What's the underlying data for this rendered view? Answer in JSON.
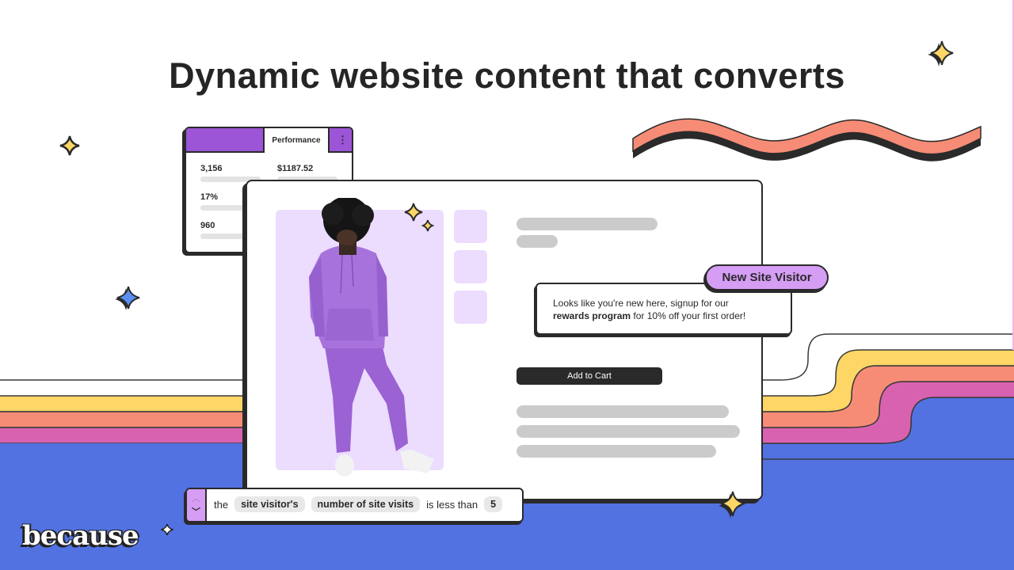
{
  "headline": "Dynamic website content that converts",
  "colors": {
    "purple_accent": "#9b55d6",
    "badge_purple": "#d69df5",
    "lilac_bg": "#ecdcfd",
    "yellow": "#fdd666",
    "salmon": "#f78c76",
    "pink": "#d962b0",
    "blue": "#5272e2",
    "dark": "#2a2a2a",
    "star_blue": "#5b8ef0"
  },
  "performance_card": {
    "tab_label": "Performance",
    "menu_icon": "kebab-menu-icon",
    "stats": [
      {
        "value": "3,156"
      },
      {
        "value": "$1187.52"
      },
      {
        "value": "17%"
      },
      {
        "value": "960"
      }
    ]
  },
  "product_card": {
    "add_to_cart_label": "Add to Cart",
    "image": "person-in-purple-tracksuit"
  },
  "popup": {
    "badge_label": "New Site Visitor",
    "message_line1": "Looks like you're new here, signup for our",
    "message_bold": "rewards program",
    "message_rest": " for 10% off your first order!"
  },
  "rule": {
    "prefix": "the",
    "subject": "site visitor's",
    "attribute": "number of site visits",
    "operator": "is less than",
    "value": "5",
    "up_icon": "chevron-up-icon",
    "down_icon": "chevron-down-icon"
  },
  "logo": {
    "text": "because"
  }
}
